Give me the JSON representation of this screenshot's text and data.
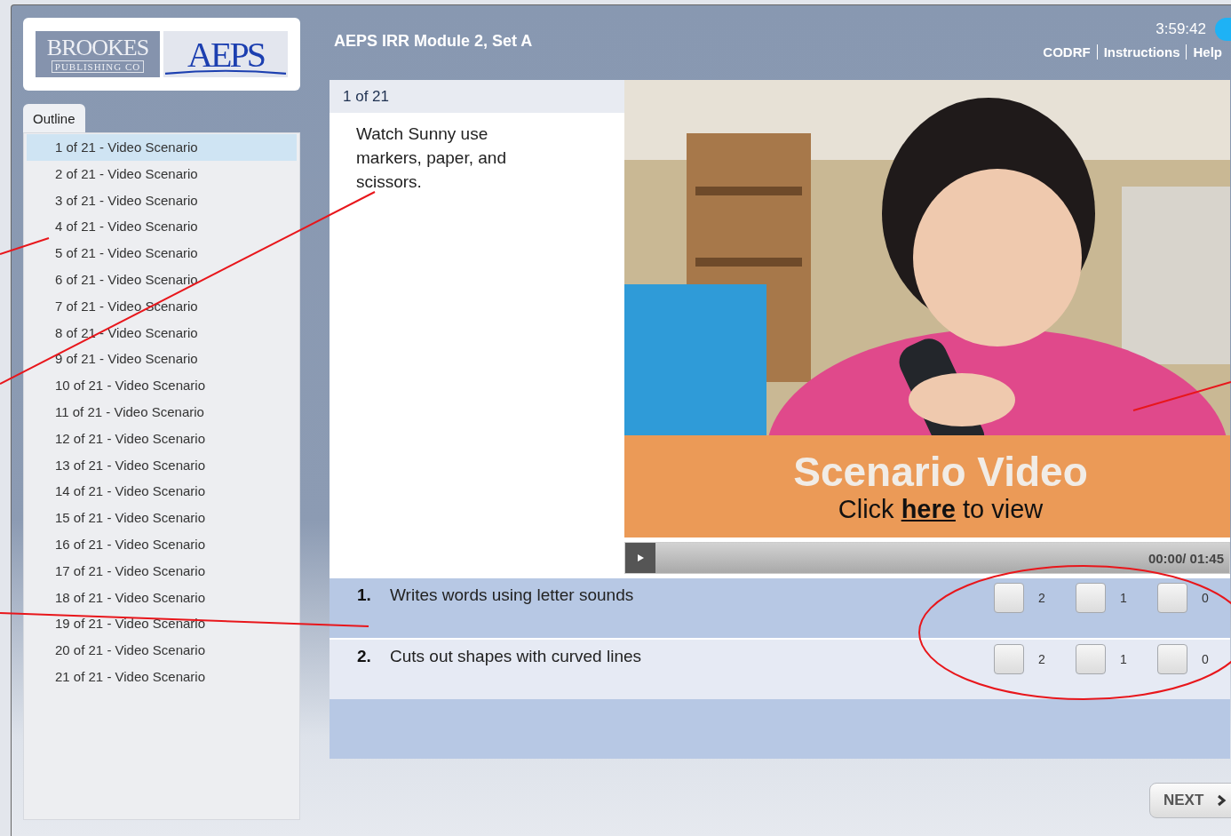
{
  "app": {
    "logo": {
      "publisher": "BROOKES",
      "publisher_sub": "PUBLISHING CO",
      "product": "AEPS"
    },
    "title": "AEPS IRR Module 2, Set A",
    "timer": "3:59:42",
    "header_links": [
      "CODRF",
      "Instructions",
      "Help"
    ]
  },
  "outline": {
    "tab": "Outline",
    "items": [
      {
        "label": "1 of 21 - Video Scenario",
        "selected": true
      },
      {
        "label": "2 of 21 - Video Scenario",
        "selected": false
      },
      {
        "label": "3 of 21 - Video Scenario",
        "selected": false
      },
      {
        "label": "4 of 21 - Video Scenario",
        "selected": false
      },
      {
        "label": "5 of 21 - Video Scenario",
        "selected": false
      },
      {
        "label": "6 of 21 - Video Scenario",
        "selected": false
      },
      {
        "label": "7 of 21 - Video Scenario",
        "selected": false
      },
      {
        "label": "8 of 21 - Video Scenario",
        "selected": false
      },
      {
        "label": "9 of 21 - Video Scenario",
        "selected": false
      },
      {
        "label": "10 of 21 - Video Scenario",
        "selected": false
      },
      {
        "label": "11 of 21 - Video Scenario",
        "selected": false
      },
      {
        "label": "12 of 21 - Video Scenario",
        "selected": false
      },
      {
        "label": "13 of 21 - Video Scenario",
        "selected": false
      },
      {
        "label": "14 of 21 - Video Scenario",
        "selected": false
      },
      {
        "label": "15 of 21 - Video Scenario",
        "selected": false
      },
      {
        "label": "16 of 21 - Video Scenario",
        "selected": false
      },
      {
        "label": "17 of 21 - Video Scenario",
        "selected": false
      },
      {
        "label": "18 of 21 - Video Scenario",
        "selected": false
      },
      {
        "label": "19 of 21 - Video Scenario",
        "selected": false
      },
      {
        "label": "20 of 21 - Video Scenario",
        "selected": false
      },
      {
        "label": "21 of 21 - Video Scenario",
        "selected": false
      }
    ]
  },
  "slide": {
    "counter": "1 of 21",
    "prompt": "Watch Sunny use markers, paper, and scissors.",
    "video": {
      "kind": "picture",
      "banner_title": "Scenario Video",
      "banner_text": "Click **here** to view",
      "time": "00:00/ 01:45"
    },
    "items": [
      {
        "number": "1.",
        "text": "Writes words using letter sounds",
        "options": [
          {
            "label": "2",
            "checked": false
          },
          {
            "label": "1",
            "checked": false
          },
          {
            "label": "0",
            "checked": false
          }
        ]
      },
      {
        "number": "2.",
        "text": "Cuts out shapes with curved lines",
        "options": [
          {
            "label": "2",
            "checked": false
          },
          {
            "label": "1",
            "checked": false
          },
          {
            "label": "0",
            "checked": false
          }
        ]
      }
    ]
  },
  "next_button": "NEXT"
}
